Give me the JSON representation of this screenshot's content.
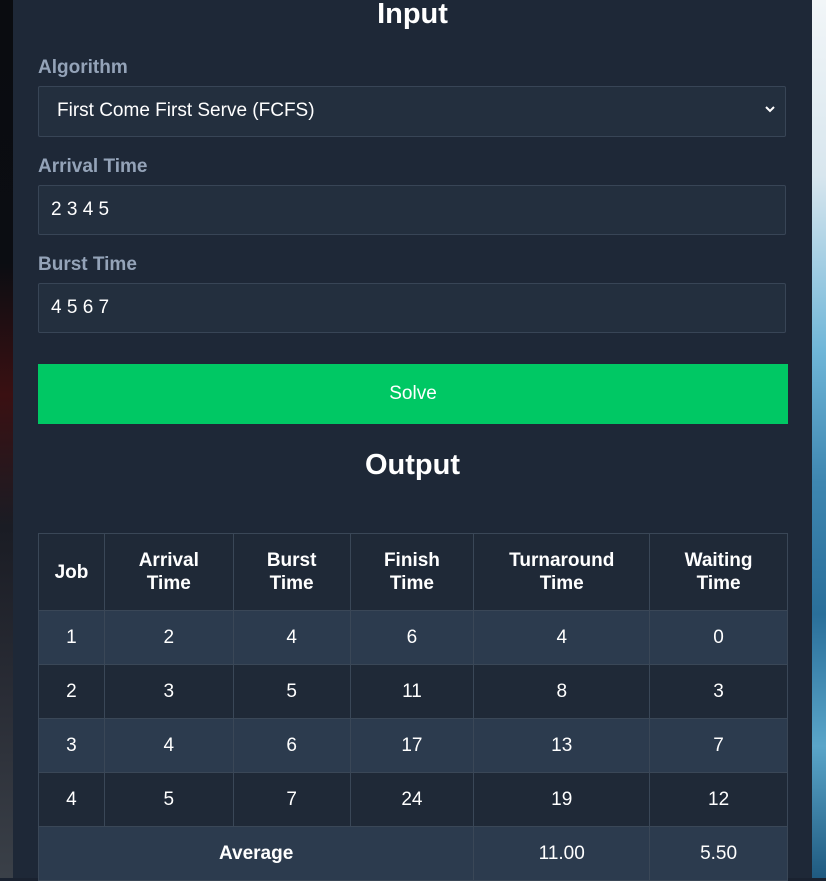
{
  "input": {
    "title": "Input",
    "algorithm": {
      "label": "Algorithm",
      "selected": "First Come First Serve (FCFS)"
    },
    "arrival": {
      "label": "Arrival Time",
      "value": "2 3 4 5"
    },
    "burst": {
      "label": "Burst Time",
      "value": "4 5 6 7"
    },
    "solve_label": "Solve"
  },
  "output": {
    "title": "Output",
    "headers": {
      "job": "Job",
      "arrival_1": "Arrival",
      "arrival_2": "Time",
      "burst_1": "Burst",
      "burst_2": "Time",
      "finish_1": "Finish",
      "finish_2": "Time",
      "turnaround_1": "Turnaround",
      "turnaround_2": "Time",
      "waiting_1": "Waiting",
      "waiting_2": "Time"
    },
    "rows": [
      [
        "1",
        "2",
        "4",
        "6",
        "4",
        "0"
      ],
      [
        "2",
        "3",
        "5",
        "11",
        "8",
        "3"
      ],
      [
        "3",
        "4",
        "6",
        "17",
        "13",
        "7"
      ],
      [
        "4",
        "5",
        "7",
        "24",
        "19",
        "12"
      ]
    ],
    "average": {
      "label": "Average",
      "turnaround": "11.00",
      "waiting": "5.50"
    }
  }
}
